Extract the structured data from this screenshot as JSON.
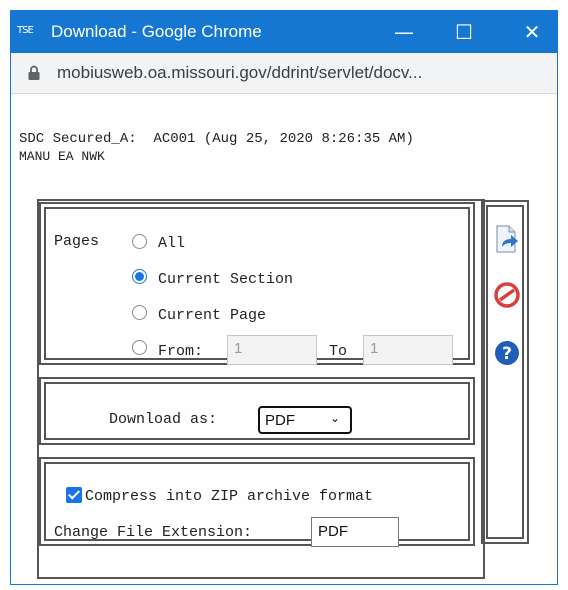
{
  "window": {
    "app_icon_text": "TSE",
    "title": "Download - Google Chrome",
    "minimize_glyph": "—",
    "maximize_glyph": "☐",
    "close_glyph": "✕",
    "url": "mobiusweb.oa.missouri.gov/ddrint/servlet/docv..."
  },
  "header": {
    "line1": "SDC Secured_A:  AC001 (Aug 25, 2020 8:26:35 AM)",
    "line2": "MANU EA NWK"
  },
  "pages": {
    "label": "Pages",
    "options": [
      {
        "label": "All",
        "selected": false
      },
      {
        "label": "Current Section",
        "selected": true
      },
      {
        "label": "Current Page",
        "selected": false
      },
      {
        "label": "From:",
        "selected": false
      }
    ],
    "from_value": "1",
    "to_label": "To",
    "to_value": "1"
  },
  "download": {
    "label": "Download as:",
    "format": "PDF"
  },
  "compress": {
    "checked": true,
    "label": "Compress into ZIP archive format",
    "ext_label": "Change File Extension:",
    "ext_value": "PDF"
  },
  "side_icons": [
    "download-page-icon",
    "cancel-icon",
    "help-icon"
  ],
  "colors": {
    "titlebar": "#1677d2",
    "accent": "#1a73e8",
    "cancel": "#d84040",
    "help": "#1f5fb8"
  }
}
